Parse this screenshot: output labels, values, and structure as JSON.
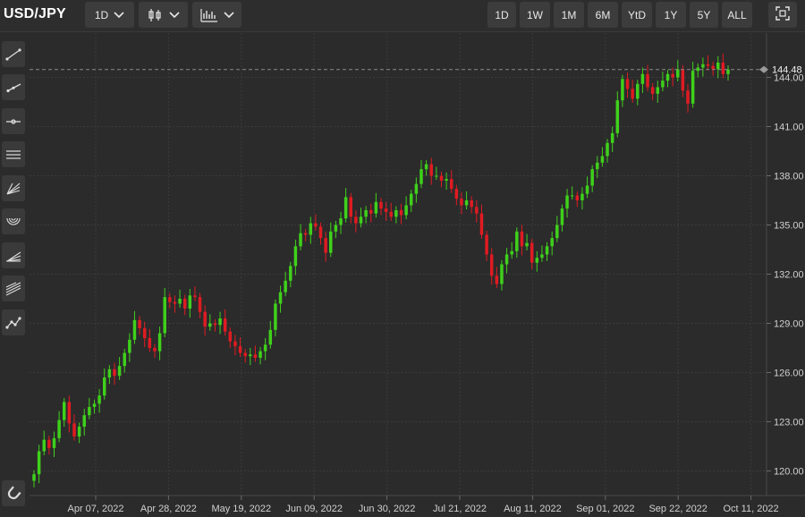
{
  "header": {
    "symbol": "USD/JPY",
    "interval": "1D",
    "ranges": [
      "1D",
      "1W",
      "1M",
      "6M",
      "YtD",
      "1Y",
      "5Y",
      "ALL"
    ]
  },
  "icons": {
    "interval_dropdown": "chevron-down-icon",
    "chart_type": "candlestick-icon",
    "indicators": "indicator-chart-icon",
    "fullscreen": "expand-icon",
    "tools": [
      "line-tool-icon",
      "ray-tool-icon",
      "horizontal-line-icon",
      "parallel-channel-icon",
      "fib-fan-icon",
      "fib-arc-icon",
      "pitchfork-icon",
      "fib-channel-icon",
      "path-tool-icon"
    ],
    "magnet": "magnet-icon"
  },
  "colors": {
    "background": "#2b2b2b",
    "grid": "#3b3b3b",
    "up": "#3fd11b",
    "down": "#e01b22",
    "current_line": "#8a8a8a"
  },
  "chart_data": {
    "type": "candlestick",
    "symbol": "USD/JPY",
    "interval": "1D",
    "x_ticks": [
      "Apr 07, 2022",
      "Apr 28, 2022",
      "May 19, 2022",
      "Jun 09, 2022",
      "Jun 30, 2022",
      "Jul 21, 2022",
      "Aug 11, 2022",
      "Sep 01, 2022",
      "Sep 22, 2022",
      "Oct 11, 2022"
    ],
    "y_ticks": [
      120.0,
      123.0,
      126.0,
      129.0,
      132.0,
      135.0,
      138.0,
      141.0,
      144.0
    ],
    "ylim": [
      118.5,
      146.7
    ],
    "current_price": 144.48,
    "grid": true,
    "closes": [
      119.8,
      121.2,
      121.9,
      121.4,
      122.0,
      123.1,
      124.2,
      122.9,
      122.1,
      122.7,
      123.4,
      123.9,
      124.1,
      124.6,
      125.7,
      126.2,
      125.8,
      126.4,
      127.2,
      128.0,
      129.2,
      128.7,
      128.1,
      127.5,
      127.3,
      128.4,
      130.6,
      130.3,
      130.2,
      130.5,
      129.9,
      130.7,
      130.6,
      129.7,
      128.8,
      129.0,
      128.9,
      129.3,
      128.5,
      127.9,
      127.6,
      127.2,
      127.0,
      127.1,
      126.9,
      127.3,
      127.7,
      128.6,
      130.2,
      130.9,
      131.6,
      132.5,
      133.7,
      134.5,
      134.4,
      135.1,
      134.9,
      134.2,
      133.3,
      134.6,
      135.0,
      135.4,
      136.7,
      135.5,
      135.1,
      135.5,
      135.9,
      135.7,
      136.4,
      136.0,
      135.8,
      135.5,
      135.9,
      135.6,
      136.2,
      136.9,
      137.5,
      138.4,
      138.7,
      138.0,
      138.0,
      137.7,
      137.8,
      137.2,
      136.6,
      136.2,
      136.5,
      136.1,
      135.7,
      134.4,
      133.2,
      131.9,
      131.4,
      132.6,
      133.2,
      133.4,
      134.6,
      133.7,
      133.9,
      132.7,
      133.0,
      133.2,
      133.7,
      134.2,
      135.0,
      136.0,
      136.8,
      136.8,
      136.5,
      136.9,
      137.4,
      138.4,
      138.8,
      139.2,
      140.0,
      140.6,
      142.6,
      143.9,
      143.3,
      142.7,
      143.6,
      144.2,
      143.4,
      143.0,
      143.4,
      143.8,
      144.2,
      144.0,
      144.5,
      143.2,
      142.4,
      144.4,
      144.6,
      144.8,
      144.7,
      144.5,
      144.9,
      144.2,
      144.48
    ]
  }
}
